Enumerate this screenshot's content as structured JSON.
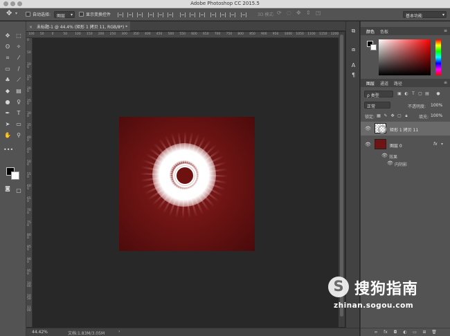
{
  "app": {
    "title": "Adobe Photoshop CC 2015.5"
  },
  "options_bar": {
    "auto_select_label": "自动选择:",
    "auto_select_value": "图层",
    "show_transform_label": "显示变换控件",
    "mode_3d_label": "3D 模式:",
    "workspace": "基本功能"
  },
  "document": {
    "tab_close": "×",
    "tab_label": "未标题-1 @ 44.4% (矩形 1 拷贝 11, RGB/8*) *"
  },
  "rulers": {
    "h_ticks": [
      "100",
      "50",
      "0",
      "50",
      "100",
      "150",
      "200",
      "250",
      "300",
      "350",
      "400",
      "450",
      "500",
      "550",
      "600",
      "650",
      "700",
      "750",
      "800",
      "850",
      "900",
      "950",
      "1000",
      "1050",
      "1100",
      "1150",
      "1200"
    ],
    "v_ticks": [
      "0",
      "50",
      "100",
      "150",
      "200",
      "250",
      "300",
      "350",
      "400",
      "450",
      "500",
      "550",
      "600",
      "650",
      "700",
      "750",
      "800",
      "850",
      "900",
      "950",
      "1000",
      "1050",
      "1100"
    ]
  },
  "status": {
    "zoom": "44.42%",
    "doc_size": "文档:1.83M/3.05M",
    "arrow": "›"
  },
  "color_panel": {
    "tabs": [
      "颜色",
      "色板"
    ],
    "active": "颜色",
    "fg": "#000000",
    "bg": "#ffffff"
  },
  "layers_panel": {
    "tabs": [
      "图层",
      "通道",
      "路径"
    ],
    "active": "图层",
    "filter_kind": "ρ 类型",
    "blend_mode": "正常",
    "opacity_label": "不透明度:",
    "opacity_value": "100%",
    "lock_label": "锁定:",
    "fill_label": "填充:",
    "fill_value": "100%",
    "layers": [
      {
        "name": "矩形 1 拷贝 11",
        "selected": true
      },
      {
        "name": "图层 0",
        "selected": false,
        "fx": "fx"
      }
    ],
    "effects_label": "效果",
    "effect_name": "内阴影"
  },
  "watermark": {
    "brand": "搜狗指南",
    "url": "zhinan.sogou.com"
  },
  "colors": {
    "accent_red": "#6e1414",
    "panel_bg": "#535353",
    "canvas_bg": "#282828"
  }
}
